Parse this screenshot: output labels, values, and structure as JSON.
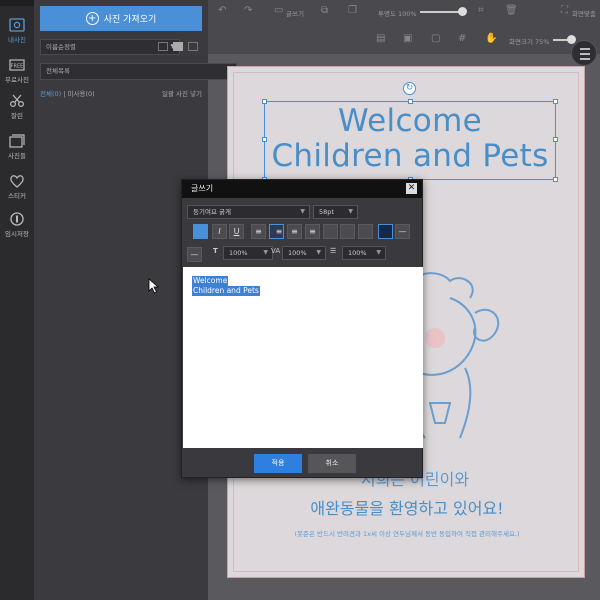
{
  "rail": {
    "items": [
      {
        "label": "내사진",
        "icon": "photo-icon"
      },
      {
        "label": "무료사진",
        "icon": "free-photo-icon"
      },
      {
        "label": "잘린",
        "icon": "scissors-icon"
      },
      {
        "label": "사진들",
        "icon": "images-icon"
      },
      {
        "label": "스티커",
        "icon": "heart-icon"
      },
      {
        "label": "임시저장",
        "icon": "save-icon"
      }
    ]
  },
  "panel": {
    "upload_label": "사진 가져오기",
    "sort_label": "이름순정렬",
    "album_label": "전체목록",
    "filter_all": "전체(0)",
    "filter_unused": "| 미사용(0)",
    "bulk_delete": "일괄 사진 넣기"
  },
  "toolbar": {
    "write_label": "글쓰기",
    "opacity_label": "투명도 100%",
    "opacity_value": 1.0,
    "zoom_label": "화면크기 75%",
    "zoom_value": 0.75,
    "fullscreen_label": "화면맞춤"
  },
  "poster": {
    "title_line1": "Welcome",
    "title_line2": "Children and Pets",
    "korean_line1": "저희는 어린이와",
    "korean_line2": "애완동물을 환영하고 있어요!",
    "korean_note": "(봇준은 반드시 반려견과 1x씨 이상 연두님께서 동반 동입하여 직접 관리해주세요.)"
  },
  "modal": {
    "title": "글쓰기",
    "font": "둥기여요 굵게",
    "size": "58pt",
    "color_a": "#4a90d9",
    "width_label": "100%",
    "spacing_label": "100%",
    "line_height_label": "100%",
    "text_line1": "Welcome",
    "text_line2": "Children and Pets",
    "apply_label": "적용",
    "cancel_label": "취소"
  }
}
